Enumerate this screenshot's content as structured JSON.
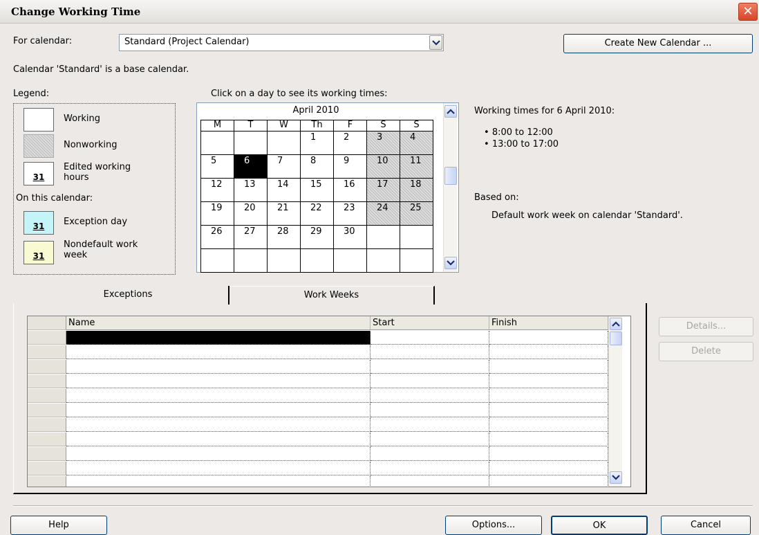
{
  "dialog": {
    "title": "Change Working Time"
  },
  "for_calendar": {
    "label": "For calendar:",
    "value": "Standard (Project Calendar)"
  },
  "create_button": "Create New Calendar ...",
  "base_calendar_note": "Calendar 'Standard' is a base calendar.",
  "legend": {
    "heading": "Legend:",
    "working": "Working",
    "nonworking": "Nonworking",
    "edited_line1": "Edited working",
    "edited_line2": "hours",
    "on_this_calendar": "On this calendar:",
    "exception_day": "Exception day",
    "nondefault_line1": "Nondefault work",
    "nondefault_line2": "week",
    "swatch_number": "31",
    "colors": {
      "exception": "#c4f4f7",
      "nondefault": "#fafad2"
    }
  },
  "calendar": {
    "instruction": "Click on a day to see its working times:",
    "month": "April 2010",
    "weekdays": [
      "M",
      "T",
      "W",
      "Th",
      "F",
      "S",
      "S"
    ],
    "weeks": [
      [
        "",
        "",
        "",
        "1",
        "2",
        "3",
        "4"
      ],
      [
        "5",
        "6",
        "7",
        "8",
        "9",
        "10",
        "11"
      ],
      [
        "12",
        "13",
        "14",
        "15",
        "16",
        "17",
        "18"
      ],
      [
        "19",
        "20",
        "21",
        "22",
        "23",
        "24",
        "25"
      ],
      [
        "26",
        "27",
        "28",
        "29",
        "30",
        "",
        ""
      ],
      [
        "",
        "",
        "",
        "",
        "",
        "",
        ""
      ]
    ],
    "selected_day": "6"
  },
  "working_times": {
    "heading": "Working times for 6 April 2010:",
    "times": [
      "8:00 to 12:00",
      "13:00 to 17:00"
    ],
    "based_on_label": "Based on:",
    "based_on_value": "Default work week on calendar 'Standard'."
  },
  "tabs": [
    "Exceptions",
    "Work Weeks"
  ],
  "exceptions_table": {
    "columns": [
      "Name",
      "Start",
      "Finish"
    ],
    "row_count": 11
  },
  "side_buttons": {
    "details": "Details...",
    "delete": "Delete"
  },
  "footer": {
    "help": "Help",
    "options": "Options...",
    "ok": "OK",
    "cancel": "Cancel"
  }
}
